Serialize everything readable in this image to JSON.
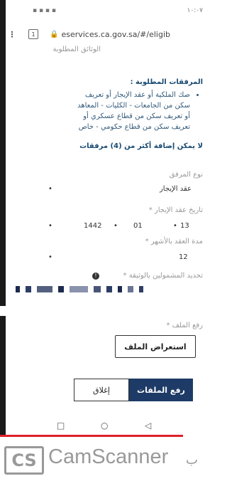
{
  "status_bar": {
    "time": "١٠:٠٧",
    "icons": [
      "signal-icon",
      "wifi-icon",
      "battery-icon",
      "alarm-icon",
      "mute-icon"
    ]
  },
  "browser": {
    "menu_glyph": "⋮",
    "tab_count": "1",
    "url": "eservices.ca.gov.sa/#/eligib"
  },
  "page": {
    "cut_heading": "الوثائق المطلوبة",
    "attachments_title": "المرفقات المطلوبة :",
    "attachments_items": [
      "صك الملكية أو عقد الإيجار أو تعريف",
      "سكن من الجامعات - الكليات - المعاهد",
      "أو تعريف سكن من قطاع عسكري أو",
      "تعريف سكن من قطاع حكومي - خاص"
    ],
    "warning": "لا يمكن إضافة أكثر من (4) مرفقات",
    "attachment_type_label": "نوع المرفق",
    "attachment_type_value": "عقد الإيجار",
    "lease_date_label": "تاريخ عقد الإيجار *",
    "lease_date": {
      "day": "13",
      "month": "01",
      "year": "1442"
    },
    "lease_duration_label": "مدة العقد بالأشهر *",
    "lease_duration_value": "12",
    "beneficiaries_label": "تحديد المشمولين بالوثيقة *",
    "upload_file_label": "رفع الملف *",
    "browse_button": "استعراض الملف",
    "upload_button": "رفع الملفات",
    "close_button": "إغلاق"
  },
  "nav": {
    "recent": "□",
    "home": "○",
    "back": "◁"
  },
  "watermark": {
    "logo": "CS",
    "name": "CamScanner",
    "by": "ب"
  },
  "colors": {
    "primary": "#1d3b66",
    "heading": "#1a4b72",
    "scan_line": "#e0202a"
  }
}
